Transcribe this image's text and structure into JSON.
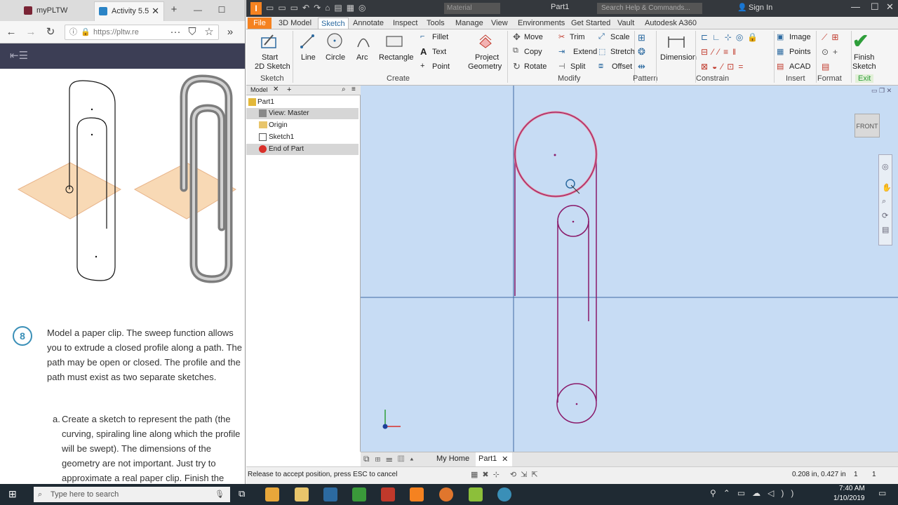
{
  "browser": {
    "tabs": [
      {
        "label": "myPLTW"
      },
      {
        "label": "Activity 5.5"
      }
    ],
    "url": "https://pltw.re",
    "step_number": "8",
    "paragraph": "Model a paper clip. The sweep function allows you to extrude a closed profile along a path. The path may be open or closed. The profile and the path must exist as two separate sketches.",
    "sub_a_label": "a.",
    "sub_a_text": "Create a sketch to represent the path (the curving, spiraling line along which the profile will be swept). The dimensions of the geometry are not important. Just try to approximate a real paper clip. Finish the"
  },
  "inventor": {
    "title": "Part1",
    "search_placeholder": "Search Help & Commands...",
    "material_placeholder": "Material",
    "sign_in": "Sign In",
    "menu_tabs": [
      "File",
      "3D Model",
      "Sketch",
      "Annotate",
      "Inspect",
      "Tools",
      "Manage",
      "View",
      "Environments",
      "Get Started",
      "Vault",
      "Autodesk A360"
    ],
    "ribbon": {
      "start_sketch_1": "Start",
      "start_sketch_2": "2D Sketch",
      "line": "Line",
      "circle": "Circle",
      "arc": "Arc",
      "rectangle": "Rectangle",
      "fillet": "Fillet",
      "text": "Text",
      "point": "Point",
      "project_1": "Project",
      "project_2": "Geometry",
      "move": "Move",
      "copy": "Copy",
      "rotate": "Rotate",
      "trim": "Trim",
      "extend": "Extend",
      "split": "Split",
      "scale": "Scale",
      "stretch": "Stretch",
      "offset": "Offset",
      "dimension": "Dimension",
      "image": "Image",
      "points": "Points",
      "acad": "ACAD",
      "finish_1": "Finish",
      "finish_2": "Sketch",
      "groups": {
        "sketch": "Sketch",
        "create": "Create",
        "modify": "Modify",
        "pattern": "Pattern",
        "constrain": "Constrain",
        "insert": "Insert",
        "format": "Format",
        "exit": "Exit"
      }
    },
    "model_tab": "Model",
    "tree": [
      {
        "label": "Part1"
      },
      {
        "label": "View: Master"
      },
      {
        "label": "Origin"
      },
      {
        "label": "Sketch1"
      },
      {
        "label": "End of Part"
      }
    ],
    "viewcube": "FRONT",
    "doc_tabs": {
      "home": "My Home",
      "part": "Part1"
    },
    "status_text": "Release to accept position, press ESC to cancel",
    "coords": "0.208 in, 0.427 in",
    "count1": "1",
    "count2": "1"
  },
  "taskbar": {
    "search_placeholder": "Type here to search",
    "time": "7:40 AM",
    "date": "1/10/2019"
  },
  "colors": {
    "sketch_line": "#8a1a6a",
    "selected_arc": "#e9778a",
    "viewport_bg": "#c7dcf4",
    "accent_file": "#f58220",
    "finish_check": "#2e9e3a"
  }
}
